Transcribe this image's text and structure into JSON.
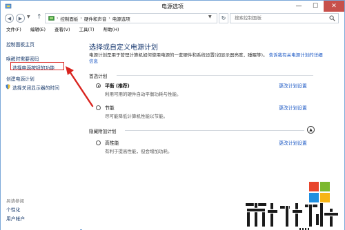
{
  "window": {
    "title": "电源选项",
    "controls": {
      "minimize": "—",
      "maximize": "☐",
      "close": "✕"
    }
  },
  "address": {
    "breadcrumb": [
      "控制面板",
      "硬件和声音",
      "电源选项"
    ],
    "separator": "›",
    "search_placeholder": "搜索控制面板"
  },
  "menubar": {
    "items": [
      "文件(F)",
      "编辑(E)",
      "查看(V)",
      "工具(T)",
      "帮助(H)"
    ]
  },
  "sidebar": {
    "home": "控制面板主页",
    "links": [
      "唤醒时需要密码",
      "选择电源按钮的功能",
      "创建电源计划",
      "选择关闭显示器的时间"
    ],
    "see_also_heading": "另请参阅",
    "see_also": [
      "个性化",
      "用户帐户"
    ]
  },
  "main": {
    "title": "选择或自定义电源计划",
    "description": "电源计划是用于管理计算机如何使用电源的一套硬件和系统设置(如显示器亮度，睡眠等)。",
    "description_link": "告诉我有关电源计划的详细信息",
    "preferred_heading": "首选计划",
    "hidden_heading": "隐藏附加计划",
    "change_label": "更改计划设置",
    "plans": [
      {
        "name": "平衡 (推荐)",
        "desc": "利用可用的硬件自动平衡功耗与性能。",
        "selected": true
      },
      {
        "name": "节能",
        "desc": "尽可能降低计算机性能以节能。",
        "selected": false
      },
      {
        "name": "高性能",
        "desc": "有利于提高性能，但会增加功耗。",
        "selected": false
      }
    ]
  },
  "colors": {
    "link": "#1a57c4",
    "heading": "#1f3f75",
    "highlight": "#d9241f",
    "close_button": "#c7504b"
  }
}
